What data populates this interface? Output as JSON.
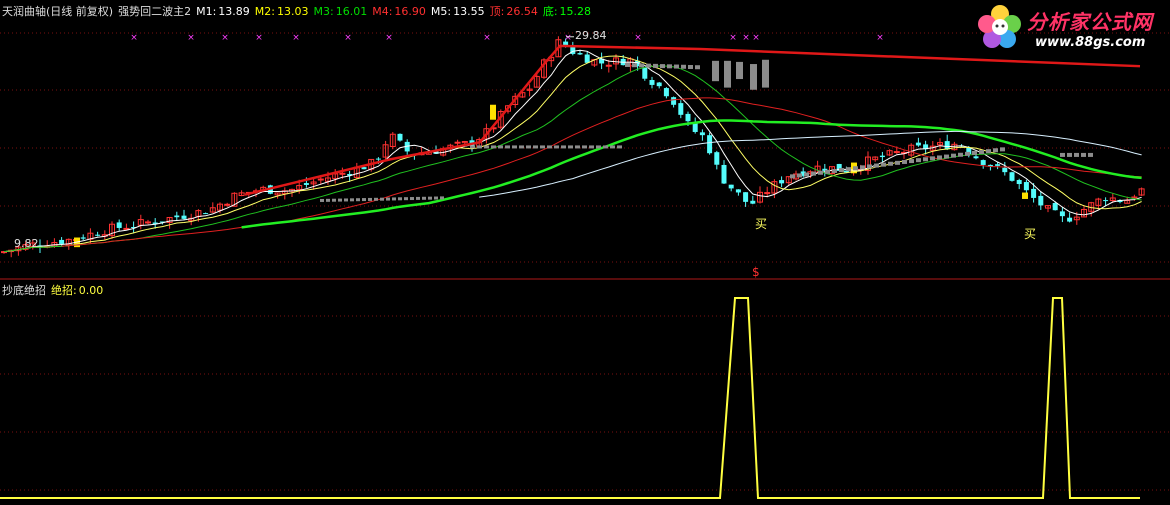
{
  "header": {
    "title": "天润曲轴(日线 前复权)",
    "indicator": "强势回二波主2",
    "m1_label": "M1:",
    "m1": "13.89",
    "m2_label": "M2:",
    "m2": "13.03",
    "m3_label": "M3:",
    "m3": "16.01",
    "m4_label": "M4:",
    "m4": "16.90",
    "m5_label": "M5:",
    "m5": "13.55",
    "top_label": "顶:",
    "top": "26.54",
    "bottom_label": "底:",
    "bottom": "15.28"
  },
  "sub_header": {
    "name": "抄底绝招",
    "label": "绝招:",
    "value": "0.00"
  },
  "logo": {
    "title": "分析家公式网",
    "url": "www.88gs.com"
  },
  "colors": {
    "up": "#ff3232",
    "down": "#54fcfc",
    "m1": "#ffffff",
    "m2": "#ffff00",
    "m3": "#00cc00",
    "m4": "#ff2020",
    "m5": "#ffffff",
    "top": "#ff2020",
    "bottom": "#00ff00",
    "signal": "#ffff40",
    "marker": "#ff40ff"
  },
  "chart_data": [
    {
      "type": "candlestick",
      "title": "天润曲轴(日线 前复权)",
      "y_range": [
        7.5,
        31.5
      ],
      "annotations": [
        {
          "text": "9.82",
          "value": 9.82,
          "label": "low"
        },
        {
          "text": "29.84",
          "value": 29.84,
          "label": "high"
        },
        {
          "text": "买",
          "label": "buy-signal"
        },
        {
          "text": "买",
          "label": "buy-signal"
        },
        {
          "text": "$",
          "label": "dollar-marker"
        }
      ],
      "price_path": [
        [
          0,
          9.6
        ],
        [
          30,
          10.3
        ],
        [
          70,
          10.8
        ],
        [
          110,
          11.8
        ],
        [
          160,
          12.6
        ],
        [
          210,
          13.6
        ],
        [
          235,
          14.9
        ],
        [
          260,
          15.5
        ],
        [
          290,
          15.4
        ],
        [
          320,
          16.4
        ],
        [
          350,
          17.2
        ],
        [
          375,
          18.0
        ],
        [
          390,
          20.6
        ],
        [
          410,
          18.8
        ],
        [
          440,
          19.2
        ],
        [
          470,
          19.8
        ],
        [
          490,
          21.0
        ],
        [
          510,
          23.5
        ],
        [
          530,
          25.0
        ],
        [
          545,
          27.4
        ],
        [
          560,
          29.4
        ],
        [
          575,
          28.2
        ],
        [
          600,
          27.3
        ],
        [
          630,
          27.6
        ],
        [
          650,
          25.8
        ],
        [
          670,
          24.3
        ],
        [
          690,
          21.2
        ],
        [
          705,
          20.3
        ],
        [
          720,
          16.8
        ],
        [
          735,
          15.3
        ],
        [
          750,
          14.0
        ],
        [
          770,
          15.6
        ],
        [
          790,
          16.9
        ],
        [
          820,
          17.6
        ],
        [
          850,
          17.3
        ],
        [
          870,
          18.2
        ],
        [
          890,
          18.7
        ],
        [
          910,
          19.2
        ],
        [
          935,
          19.5
        ],
        [
          960,
          19.8
        ],
        [
          975,
          18.6
        ],
        [
          990,
          17.8
        ],
        [
          1010,
          16.7
        ],
        [
          1030,
          14.9
        ],
        [
          1050,
          13.4
        ],
        [
          1065,
          12.6
        ],
        [
          1085,
          13.7
        ],
        [
          1105,
          14.8
        ],
        [
          1125,
          14.4
        ],
        [
          1140,
          15.4
        ]
      ]
    },
    {
      "type": "line",
      "title": "抄底绝招",
      "series": [
        {
          "name": "绝招",
          "values_by_x": [
            [
              0,
              0
            ],
            [
              720,
              0
            ],
            [
              735,
              1
            ],
            [
              748,
              1
            ],
            [
              758,
              0
            ],
            [
              1043,
              0
            ],
            [
              1053,
              1
            ],
            [
              1062,
              1
            ],
            [
              1070,
              0
            ],
            [
              1140,
              0
            ]
          ]
        }
      ],
      "y_range": [
        0,
        1
      ]
    }
  ]
}
